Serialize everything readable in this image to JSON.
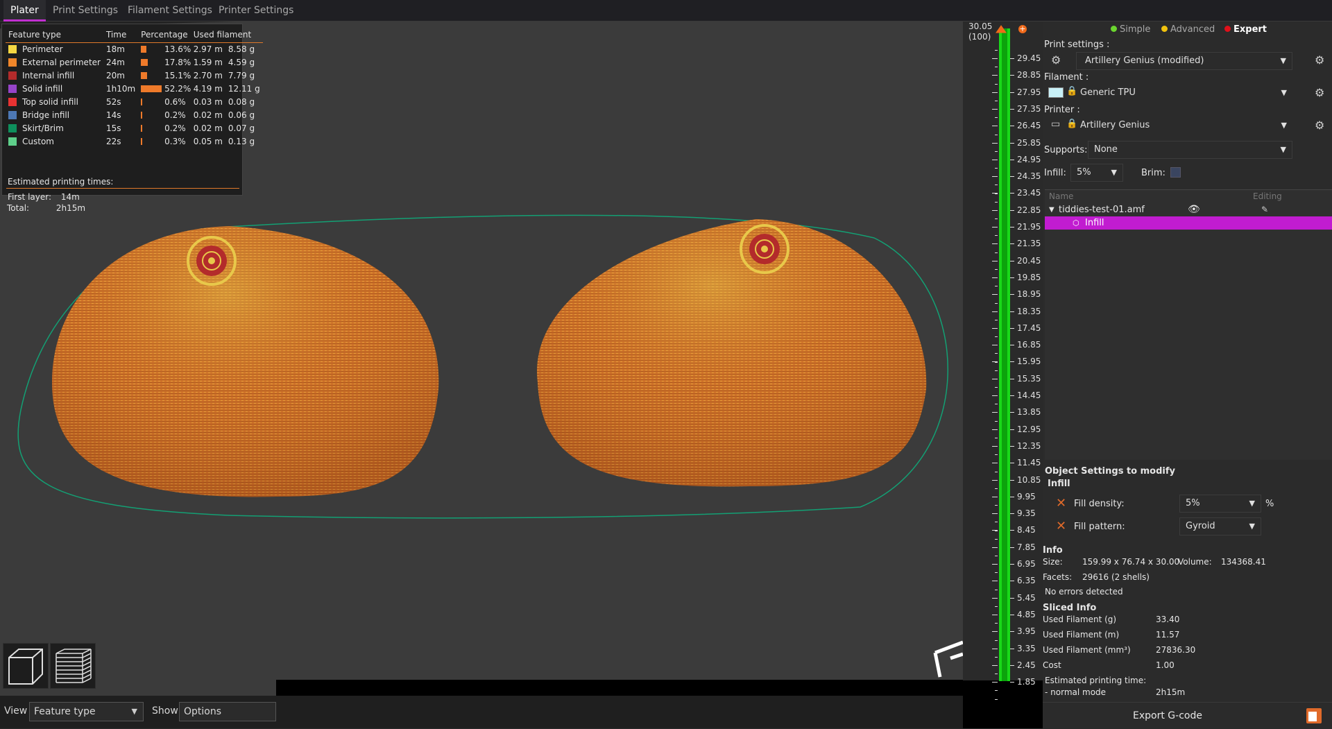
{
  "tabs": [
    "Plater",
    "Print Settings",
    "Filament Settings",
    "Printer Settings"
  ],
  "legend": {
    "headers": [
      "Feature type",
      "Time",
      "Percentage",
      "Used filament"
    ],
    "rows": [
      {
        "name": "Perimeter",
        "color": "#f5d742",
        "time": "18m",
        "pct": "13.6%",
        "length": "2.97 m",
        "weight": "8.58 g",
        "bar": 0.136
      },
      {
        "name": "External perimeter",
        "color": "#f0862a",
        "time": "24m",
        "pct": "17.8%",
        "length": "1.59 m",
        "weight": "4.59 g",
        "bar": 0.178
      },
      {
        "name": "Internal infill",
        "color": "#b32b2b",
        "time": "20m",
        "pct": "15.1%",
        "length": "2.70 m",
        "weight": "7.79 g",
        "bar": 0.151
      },
      {
        "name": "Solid infill",
        "color": "#9744c9",
        "time": "1h10m",
        "pct": "52.2%",
        "length": "4.19 m",
        "weight": "12.11 g",
        "bar": 0.522
      },
      {
        "name": "Top solid infill",
        "color": "#e83232",
        "time": "52s",
        "pct": "0.6%",
        "length": "0.03 m",
        "weight": "0.08 g",
        "bar": 0.006
      },
      {
        "name": "Bridge infill",
        "color": "#4d78b5",
        "time": "14s",
        "pct": "0.2%",
        "length": "0.02 m",
        "weight": "0.06 g",
        "bar": 0.002
      },
      {
        "name": "Skirt/Brim",
        "color": "#0e8f5c",
        "time": "15s",
        "pct": "0.2%",
        "length": "0.02 m",
        "weight": "0.07 g",
        "bar": 0.002
      },
      {
        "name": "Custom",
        "color": "#5ecf8a",
        "time": "22s",
        "pct": "0.3%",
        "length": "0.05 m",
        "weight": "0.13 g",
        "bar": 0.003
      }
    ],
    "est_label": "Estimated printing times:",
    "first_layer_label": "First layer:",
    "first_layer": "14m",
    "total_label": "Total:",
    "total": "2h15m"
  },
  "bottombar": {
    "view_label": "View",
    "view_value": "Feature type",
    "show_label": "Show",
    "show_value": "Options"
  },
  "ruler": {
    "top_value": "30.05",
    "top_layer": "(100)",
    "ticks": [
      "29.45",
      "28.85",
      "27.95",
      "27.35",
      "26.45",
      "25.85",
      "24.95",
      "24.35",
      "23.45",
      "22.85",
      "21.95",
      "21.35",
      "20.45",
      "19.85",
      "18.95",
      "18.35",
      "17.45",
      "16.85",
      "15.95",
      "15.35",
      "14.45",
      "13.85",
      "12.95",
      "12.35",
      "11.45",
      "10.85",
      "9.95",
      "9.35",
      "8.45",
      "7.85",
      "6.95",
      "6.35",
      "5.45",
      "4.85",
      "3.95",
      "3.35",
      "2.45",
      "1.85"
    ]
  },
  "modes": {
    "simple": "Simple",
    "advanced": "Advanced",
    "expert": "Expert"
  },
  "colors": {
    "simple": "#6bd62f",
    "advanced": "#f0c20e",
    "expert": "#e0101a",
    "accent": "#c11cd0"
  },
  "print_settings": {
    "label": "Print settings :",
    "value": "Artillery Genius (modified)"
  },
  "filament": {
    "label": "Filament :",
    "value": "Generic TPU",
    "swatch": "#c8f0f7"
  },
  "printer": {
    "label": "Printer :",
    "value": "Artillery Genius"
  },
  "supports": {
    "label": "Supports:",
    "value": "None"
  },
  "infill": {
    "label": "Infill:",
    "value": "5%"
  },
  "brim": {
    "label": "Brim:"
  },
  "objects": {
    "col_name": "Name",
    "col_editing": "Editing",
    "file": "tiddies-test-01.amf",
    "child": "Infill"
  },
  "object_settings": {
    "title": "Object Settings to modify",
    "group": "Infill",
    "density_label": "Fill density:",
    "density_value": "5%",
    "density_unit": "%",
    "pattern_label": "Fill pattern:",
    "pattern_value": "Gyroid"
  },
  "info": {
    "title": "Info",
    "size_label": "Size:",
    "size": "159.99 x 76.74 x 30.00",
    "volume_label": "Volume:",
    "volume": "134368.41",
    "facets_label": "Facets:",
    "facets": "29616 (2 shells)",
    "errors": "No errors detected"
  },
  "sliced": {
    "title": "Sliced Info",
    "rows": [
      {
        "k": "Used Filament (g)",
        "v": "33.40"
      },
      {
        "k": "Used Filament (m)",
        "v": "11.57"
      },
      {
        "k": "Used Filament (mm³)",
        "v": "27836.30"
      },
      {
        "k": "Cost",
        "v": "1.00"
      }
    ],
    "est_label": "Estimated printing time:",
    "mode_label": "- normal mode",
    "mode_value": "2h15m"
  },
  "export_label": "Export G-code"
}
